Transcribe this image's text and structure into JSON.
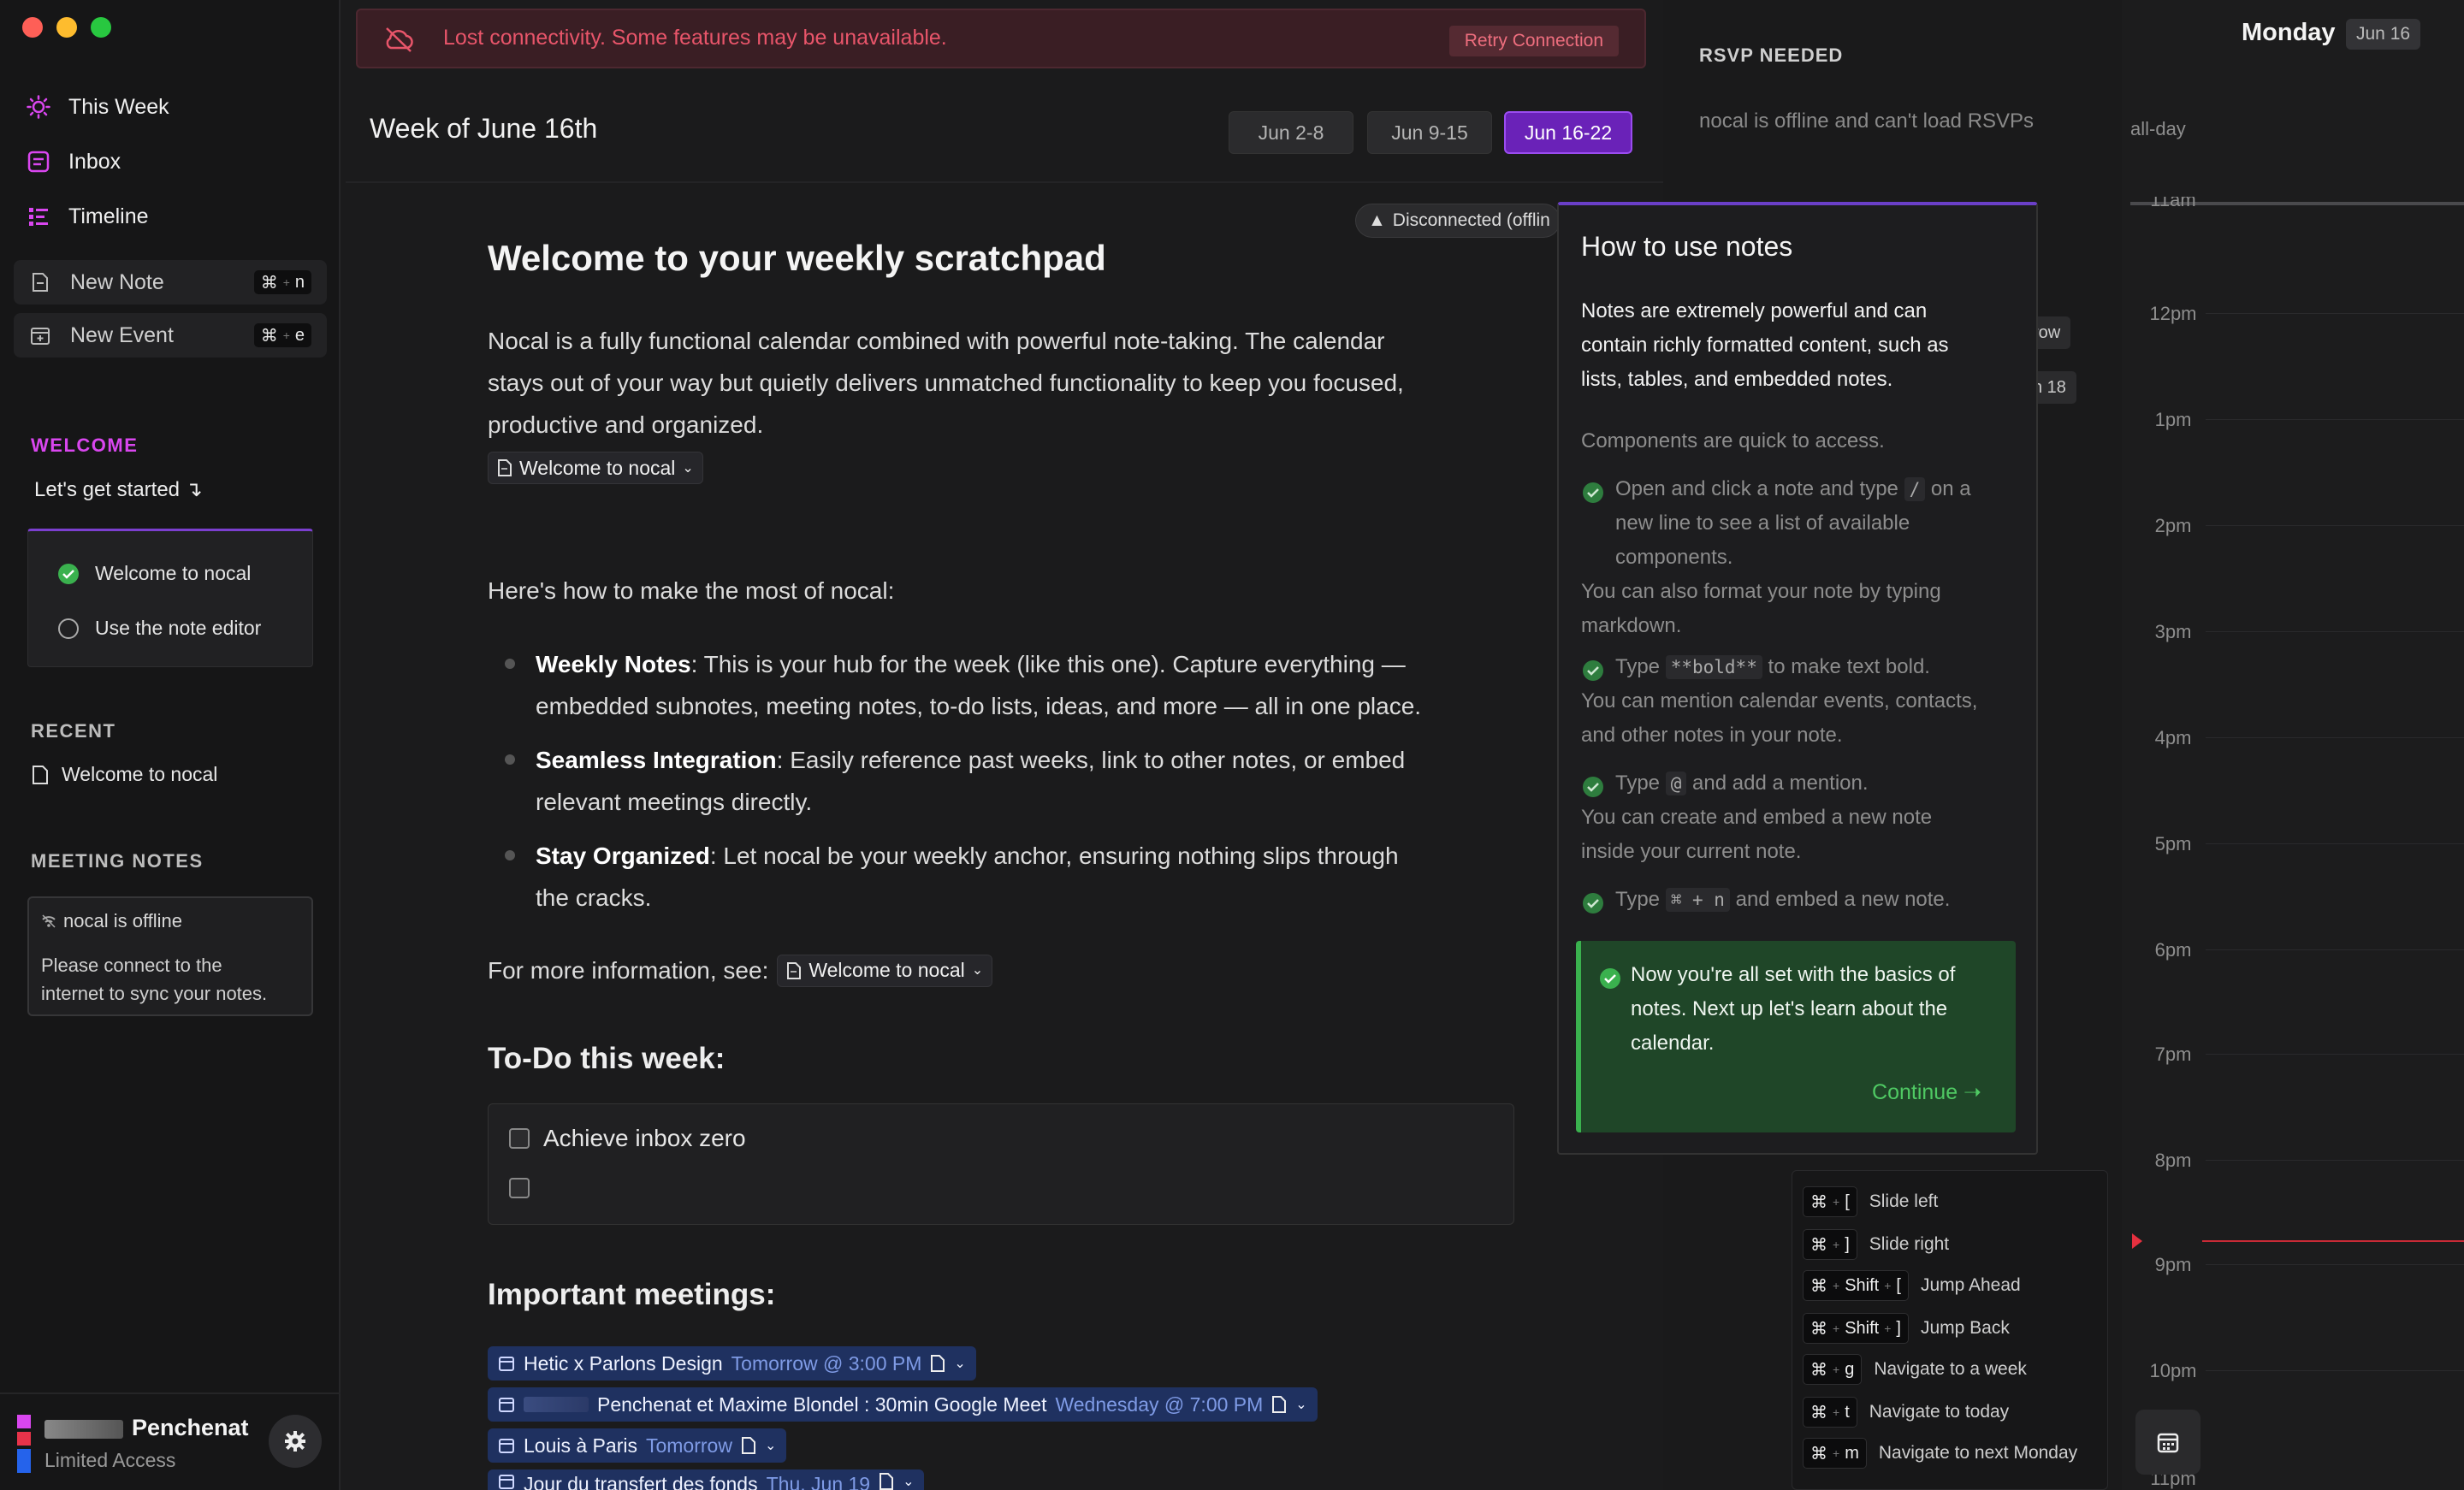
{
  "sidebar": {
    "nav": [
      {
        "label": "This Week",
        "icon": "sun-icon"
      },
      {
        "label": "Inbox",
        "icon": "inbox-icon"
      },
      {
        "label": "Timeline",
        "icon": "timeline-icon"
      }
    ],
    "new_note": {
      "label": "New Note",
      "shortcut_cmd": "⌘",
      "shortcut_key": "n"
    },
    "new_event": {
      "label": "New Event",
      "shortcut_cmd": "⌘",
      "shortcut_key": "e"
    },
    "welcome": {
      "heading": "WELCOME",
      "subheading": "Let's get started ↴",
      "items": [
        {
          "label": "Welcome to nocal",
          "done": true
        },
        {
          "label": "Use the note editor",
          "done": false
        }
      ]
    },
    "recent": {
      "heading": "RECENT",
      "items": [
        "Welcome to nocal"
      ]
    },
    "meeting_notes": {
      "heading": "MEETING NOTES",
      "offline_title": "nocal is offline",
      "offline_body_1": "Please connect to the",
      "offline_body_2": "internet to sync your notes."
    },
    "user": {
      "name": "Penchenat",
      "status": "Limited Access"
    }
  },
  "banner": {
    "message": "Lost connectivity. Some features may be unavailable.",
    "retry": "Retry Connection"
  },
  "week": {
    "title": "Week of June 16th",
    "tabs": [
      "Jun 2-8",
      "Jun 9-15",
      "Jun 16-22"
    ],
    "active_tab": "Jun 16-22",
    "disconnected": "Disconnected (offlin"
  },
  "doc": {
    "heading": "Welcome to your weekly scratchpad",
    "intro_1": "Nocal is a fully functional calendar combined with powerful note-taking. The calendar",
    "intro_2": "stays out of your way but quietly delivers unmatched functionality to keep you focused,",
    "intro_3": "productive and organized.",
    "chip": "Welcome to nocal",
    "how": "Here's how to make the most of nocal:",
    "bullets": [
      {
        "bold": "Weekly Notes",
        "l1": ": This is your hub for the week (like this one). Capture everything —",
        "l2": "embedded subnotes, meeting notes, to-do lists, ideas, and more — all in one place."
      },
      {
        "bold": "Seamless Integration",
        "l1": ": Easily reference past weeks, link to other notes, or embed",
        "l2": "relevant meetings directly."
      },
      {
        "bold": "Stay Organized",
        "l1": ": Let nocal be your weekly anchor, ensuring nothing slips through",
        "l2": "the cracks."
      }
    ],
    "more": "For more information, see:",
    "todo_heading": "To-Do this week:",
    "todos": [
      "Achieve inbox zero",
      ""
    ],
    "meetings_heading": "Important meetings:",
    "meetings": [
      {
        "title": "Hetic x Parlons Design",
        "time": "Tomorrow @ 3:00 PM"
      },
      {
        "title": "Penchenat et Maxime Blondel : 30min Google Meet",
        "time": "Wednesday @ 7:00 PM"
      },
      {
        "title": "Louis à Paris",
        "time": "Tomorrow"
      },
      {
        "title": "Jour du transfert des fonds",
        "time": "Thu, Jun 19"
      }
    ]
  },
  "rsvp": {
    "heading": "RSVP NEEDED",
    "offline": "nocal is offline and can't load RSVPs",
    "frag_1": "row",
    "frag_2": "n 18"
  },
  "popover": {
    "title": "How to use notes",
    "p1": [
      "Notes are extremely powerful and can",
      "contain richly formatted content, such as",
      "lists, tables, and embedded notes."
    ],
    "p2": "Components are quick to access.",
    "s1": [
      "Open and click a note and type",
      "on a",
      "new line to see a list of available",
      "components."
    ],
    "s1_code": "/",
    "s1b": [
      "You can also format your note by typing",
      "markdown."
    ],
    "s2": [
      "Type",
      "to make text bold."
    ],
    "s2_code": "**bold**",
    "s2b": [
      "You can mention calendar events, contacts,",
      "and other notes in your note."
    ],
    "s3": [
      "Type",
      "and add a mention."
    ],
    "s3_code": "@",
    "s3b": [
      "You can create and embed a new note",
      "inside your current note."
    ],
    "s4": [
      "Type",
      "and embed a new note."
    ],
    "s4_code": "⌘ + n",
    "done": [
      "Now you're all set with the basics of",
      "notes. Next up let's learn about the",
      "calendar."
    ],
    "continue": "Continue ➝"
  },
  "shortcuts": [
    {
      "keys": [
        "⌘",
        "["
      ],
      "label": "Slide left"
    },
    {
      "keys": [
        "⌘",
        "]"
      ],
      "label": "Slide right"
    },
    {
      "keys": [
        "⌘",
        "Shift",
        "["
      ],
      "label": "Jump Ahead"
    },
    {
      "keys": [
        "⌘",
        "Shift",
        "]"
      ],
      "label": "Jump Back"
    },
    {
      "keys": [
        "⌘",
        "g"
      ],
      "label": "Navigate to a week"
    },
    {
      "keys": [
        "⌘",
        "t"
      ],
      "label": "Navigate to today"
    },
    {
      "keys": [
        "⌘",
        "m"
      ],
      "label": "Navigate to next Monday"
    }
  ],
  "calendar": {
    "day": "Monday",
    "date": "Jun 16",
    "allday": "all-day",
    "hours": [
      "11am",
      "12pm",
      "1pm",
      "2pm",
      "3pm",
      "4pm",
      "5pm",
      "6pm",
      "7pm",
      "8pm",
      "9pm",
      "10pm",
      "11pm"
    ]
  },
  "colors": {
    "accent": "#7b2fd6",
    "danger": "#e8556a",
    "success": "#3ab14e",
    "meeting": "#1f3160"
  }
}
